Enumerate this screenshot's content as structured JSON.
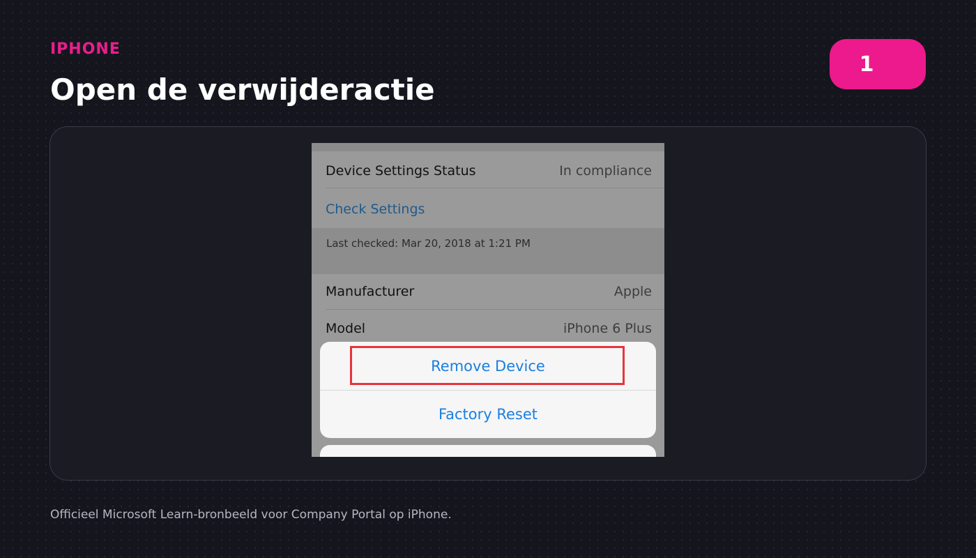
{
  "header": {
    "eyebrow": "IPHONE",
    "title": "Open de verwijderactie",
    "step_number": "1"
  },
  "screenshot": {
    "rows": [
      {
        "label": "Device Settings Status",
        "value": "In compliance"
      }
    ],
    "check_settings_link": "Check Settings",
    "last_checked": "Last checked: Mar 20, 2018 at 1:21 PM",
    "device_rows": [
      {
        "label": "Manufacturer",
        "value": "Apple"
      },
      {
        "label": "Model",
        "value": "iPhone 6 Plus"
      }
    ],
    "action_sheet": {
      "remove_device": "Remove Device",
      "factory_reset": "Factory Reset"
    }
  },
  "caption": "Officieel Microsoft Learn-bronbeeld voor Company Portal op iPhone.",
  "colors": {
    "accent": "#ec1a8c",
    "background": "#15151d",
    "ios_blue": "#1a7fe0",
    "highlight_red": "#e8333b"
  }
}
